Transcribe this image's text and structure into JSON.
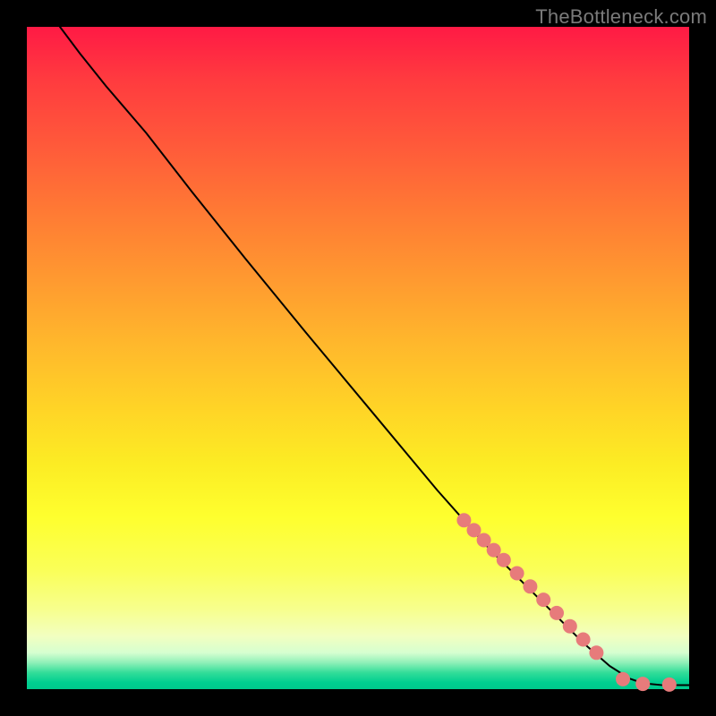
{
  "attribution": "TheBottleneck.com",
  "chart_data": {
    "type": "line",
    "title": "",
    "xlabel": "",
    "ylabel": "",
    "xlim": [
      0,
      100
    ],
    "ylim": [
      0,
      100
    ],
    "grid": false,
    "legend": false,
    "series": [
      {
        "name": "curve",
        "x": [
          5,
          8,
          12,
          18,
          25,
          33,
          42,
          52,
          62,
          70,
          78,
          84,
          88,
          91,
          93,
          96,
          100
        ],
        "y": [
          100,
          96,
          91,
          84,
          75,
          65,
          54,
          42,
          30,
          21,
          13,
          7,
          3.5,
          1.6,
          0.9,
          0.6,
          0.6
        ]
      }
    ],
    "markers": [
      {
        "name": "points",
        "color": "#e77b7b",
        "radius": 8,
        "x": [
          66,
          67.5,
          69,
          70.5,
          72,
          74,
          76,
          78,
          80,
          82,
          84,
          86,
          90,
          93,
          97
        ],
        "y": [
          25.5,
          24,
          22.5,
          21,
          19.5,
          17.5,
          15.5,
          13.5,
          11.5,
          9.5,
          7.5,
          5.5,
          1.5,
          0.8,
          0.7
        ]
      }
    ]
  }
}
